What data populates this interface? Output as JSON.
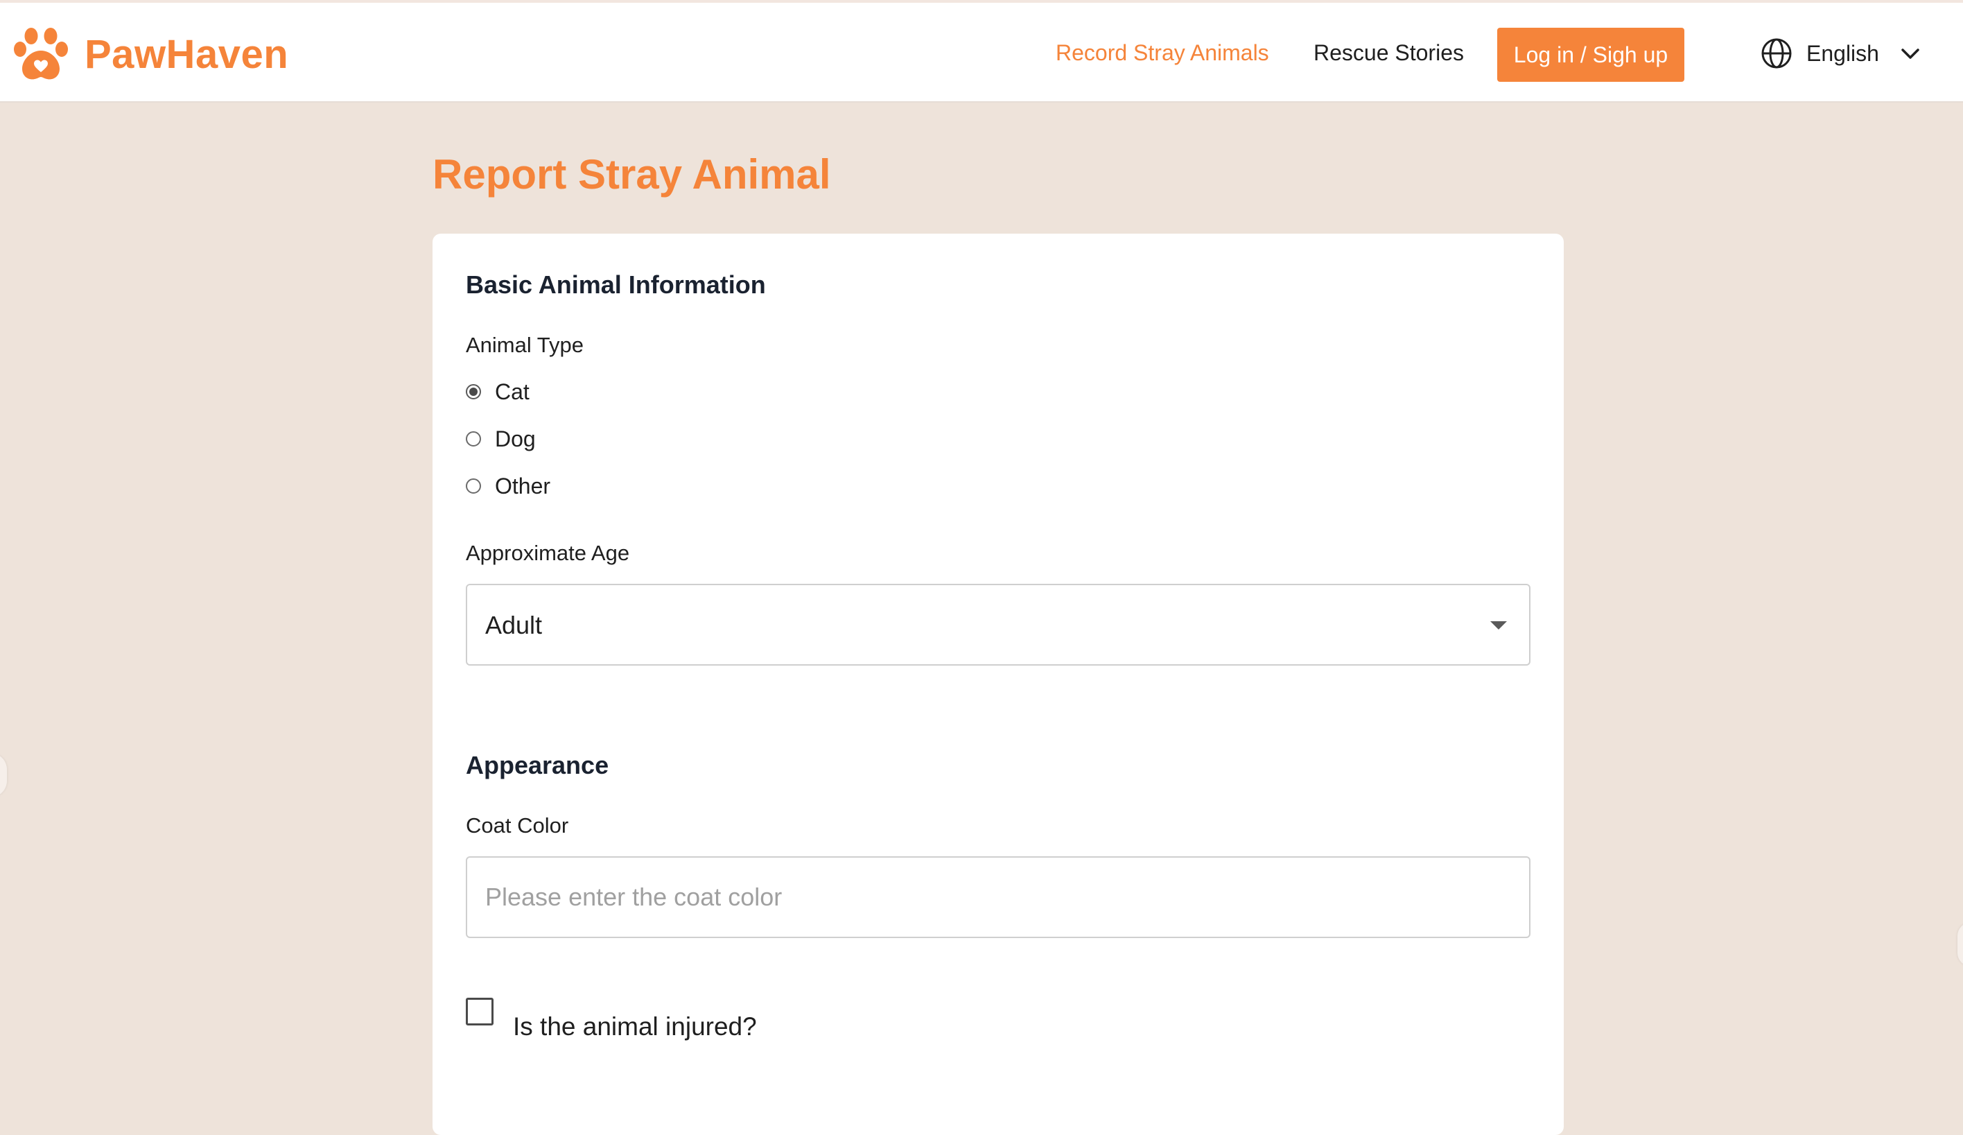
{
  "brand": {
    "name": "PawHaven",
    "accent_color": "#f5843a",
    "logo_icon": "paw-heart-icon"
  },
  "nav": {
    "record_label": "Record Stray Animals",
    "stories_label": "Rescue Stories",
    "login_label": "Log in / Sigh up",
    "language": {
      "icon": "globe-icon",
      "label": "English",
      "dropdown_icon": "chevron-down-icon"
    }
  },
  "page": {
    "title": "Report Stray Animal",
    "background_color": "#eee3da"
  },
  "form": {
    "basic": {
      "title": "Basic Animal Information",
      "animal_type": {
        "label": "Animal Type",
        "options": [
          {
            "label": "Cat",
            "checked": true
          },
          {
            "label": "Dog",
            "checked": false
          },
          {
            "label": "Other",
            "checked": false
          }
        ]
      },
      "age": {
        "label": "Approximate Age",
        "selected": "Adult"
      }
    },
    "appearance": {
      "title": "Appearance",
      "coat_color": {
        "label": "Coat Color",
        "value": "",
        "placeholder": "Please enter the coat color"
      },
      "injured": {
        "label": "Is the animal injured?",
        "checked": false
      }
    }
  }
}
